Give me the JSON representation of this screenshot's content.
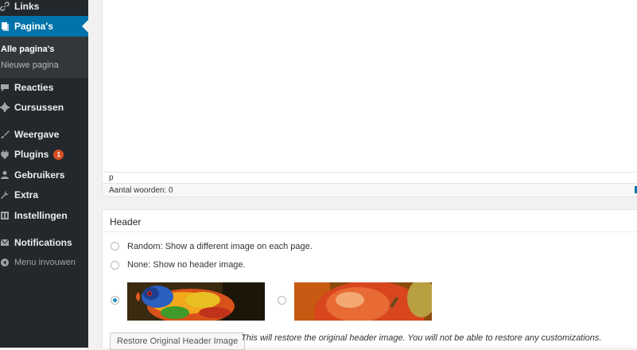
{
  "sidebar": {
    "items": [
      {
        "label": "Links",
        "icon": "link-icon"
      },
      {
        "label": "Pagina's",
        "icon": "page-icon",
        "active": true
      },
      {
        "label": "Reacties",
        "icon": "comment-icon"
      },
      {
        "label": "Cursussen",
        "icon": "gear-icon"
      },
      {
        "label": "Weergave",
        "icon": "brush-icon"
      },
      {
        "label": "Plugins",
        "icon": "plugin-icon",
        "badge": "1"
      },
      {
        "label": "Gebruikers",
        "icon": "users-icon"
      },
      {
        "label": "Extra",
        "icon": "wrench-icon"
      },
      {
        "label": "Instellingen",
        "icon": "settings-icon"
      },
      {
        "label": "Notifications",
        "icon": "envelope-icon"
      },
      {
        "label": "Menu invouwen",
        "icon": "collapse-icon"
      }
    ],
    "submenu": [
      {
        "label": "Alle pagina's",
        "current": true
      },
      {
        "label": "Nieuwe pagina"
      }
    ]
  },
  "editor": {
    "path": "p",
    "word_count": "Aantal woorden: 0"
  },
  "header_box": {
    "title": "Header",
    "options": {
      "random": "Random: Show a different image on each page.",
      "none": "None: Show no header image."
    },
    "restore_button": "Restore Original Header Image",
    "restore_note": "This will restore the original header image. You will not be able to restore any customizations."
  },
  "colors": {
    "sidebar_bg": "#23282d",
    "active_bg": "#0073aa",
    "badge_bg": "#d54e21"
  }
}
